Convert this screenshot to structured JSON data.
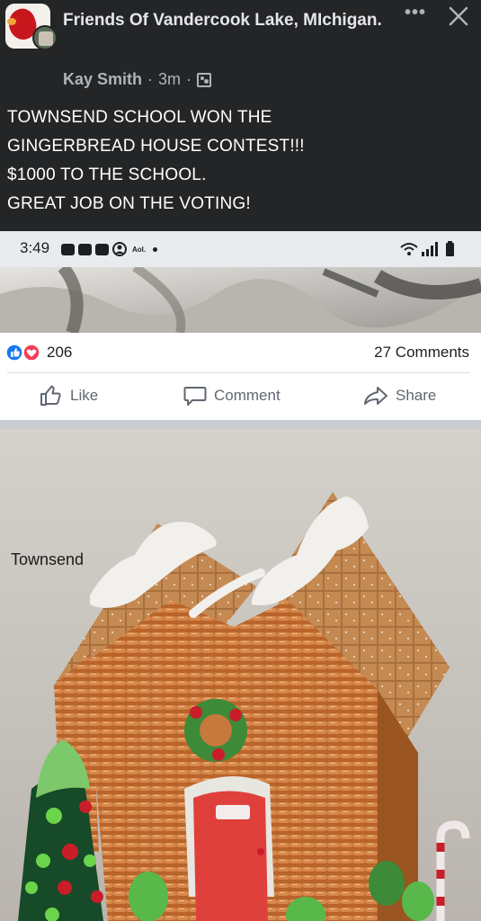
{
  "header": {
    "group_name": "Friends Of Vandercook Lake, MIchigan.",
    "author": "Kay Smith",
    "separator": "·",
    "time_ago": "3m",
    "icons": {
      "more": "more-icon",
      "close": "close-icon",
      "privacy": "group-members-icon"
    }
  },
  "post": {
    "lines": [
      "TOWNSEND SCHOOL WON THE",
      "GINGERBREAD HOUSE CONTEST!!!",
      "$1000 TO THE SCHOOL.",
      "GREAT JOB ON THE VOTING!"
    ]
  },
  "screenshot": {
    "status_bar": {
      "time": "3:49",
      "carrier": "Aol."
    },
    "reactions": {
      "count": "206",
      "types": [
        "like",
        "love"
      ]
    },
    "comments": "27 Comments",
    "actions": {
      "like": "Like",
      "comment": "Comment",
      "share": "Share"
    },
    "photo_label": "Townsend"
  },
  "colors": {
    "background": "#242526",
    "text": "#e4e6eb",
    "secondary_text": "#b0b3b8",
    "like_blue": "#1877f2",
    "love_red": "#f33e58",
    "action_gray": "#606770"
  }
}
